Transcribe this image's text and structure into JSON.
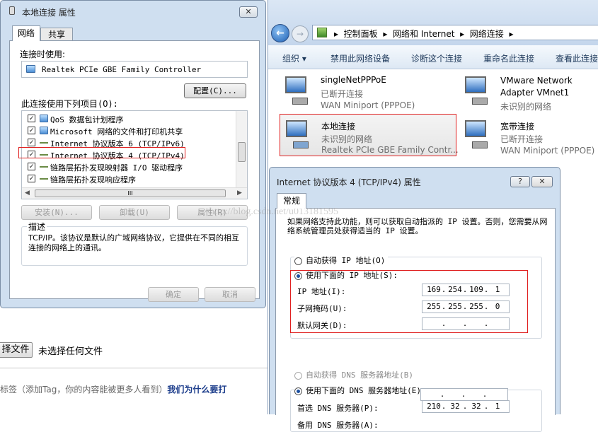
{
  "left_dialog": {
    "title": "本地连接 属性",
    "close": "✕",
    "tabs": [
      "网络",
      "共享"
    ],
    "connect_using_label": "连接时使用:",
    "adapter": "Realtek PCIe GBE Family Controller",
    "configure_btn": "配置(C)...",
    "items_label": "此连接使用下列项目(O):",
    "items": [
      "QoS 数据包计划程序",
      "Microsoft 网络的文件和打印机共享",
      "Internet 协议版本 6 (TCP/IPv6)",
      "Internet 协议版本 4 (TCP/IPv4)",
      "链路层拓扑发现映射器 I/O 驱动程序",
      "链路层拓扑发现响应程序"
    ],
    "scroll_mark": "III",
    "install_btn": "安装(N)...",
    "uninstall_btn": "卸载(U)",
    "properties_btn": "属性(R)",
    "desc_label": "描述",
    "desc_text": "TCP/IP。该协议是默认的广域网络协议，它提供在不同的相互连接的网络上的通讯。",
    "ok_btn": "确定",
    "cancel_btn": "取消"
  },
  "explorer": {
    "breadcrumb": [
      "控制面板",
      "网络和 Internet",
      "网络连接"
    ],
    "toolbar": [
      "组织 ▾",
      "禁用此网络设备",
      "诊断这个连接",
      "重命名此连接",
      "查看此连接"
    ],
    "connections": [
      {
        "name": "singleNetPPPoE",
        "status": "已断开连接",
        "device": "WAN Miniport (PPPOE)"
      },
      {
        "name": "VMware Network Adapter VMnet1",
        "status": "未识别的网络",
        "device": ""
      },
      {
        "name": "本地连接",
        "status": "未识别的网络",
        "device": "Realtek PCIe GBE Family Contr..."
      },
      {
        "name": "宽带连接",
        "status": "已断开连接",
        "device": "WAN Miniport (PPPOE)"
      }
    ]
  },
  "ipv4_dialog": {
    "title": "Internet 协议版本 4 (TCP/IPv4) 属性",
    "tab": "常规",
    "intro": "如果网络支持此功能，则可以获取自动指派的 IP 设置。否则，您需要从网络系统管理员处获得适当的 IP 设置。",
    "auto_ip": "自动获得 IP 地址(O)",
    "use_ip": "使用下面的 IP 地址(S):",
    "ip_label": "IP 地址(I):",
    "ip": [
      "169",
      "254",
      "109",
      "1"
    ],
    "mask_label": "子网掩码(U):",
    "mask": [
      "255",
      "255",
      "255",
      "0"
    ],
    "gw_label": "默认网关(D):",
    "auto_dns": "自动获得 DNS 服务器地址(B)",
    "use_dns": "使用下面的 DNS 服务器地址(E):",
    "dns1_label": "首选 DNS 服务器(P):",
    "dns1": [
      "210",
      "32",
      "32",
      "1"
    ],
    "dns2_label": "备用 DNS 服务器(A):"
  },
  "webpage": {
    "choose_file_btn": "择文件",
    "no_file": "未选择任何文件",
    "tag_hint": "标签（添加Tag，你的内容能被更多人看到）",
    "tag_link": "我们为什么要打"
  },
  "watermark": "http://blog.csdn.net/u013181595",
  "colors": {
    "highlight_border": "#e02020",
    "window_frame": "#cfdff0",
    "link_blue": "#1a3b8a"
  }
}
